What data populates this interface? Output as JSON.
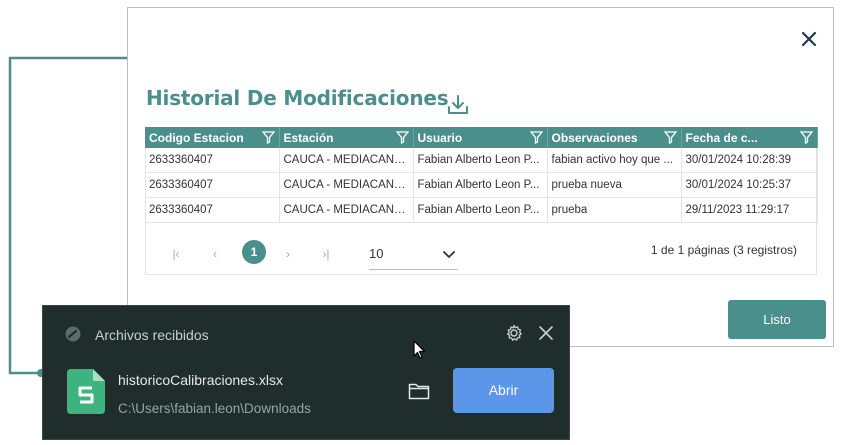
{
  "modal": {
    "title": "Historial De Modificaciones",
    "columns": [
      {
        "label": "Codigo Estacion"
      },
      {
        "label": "Estación"
      },
      {
        "label": "Usuario"
      },
      {
        "label": "Observaciones"
      },
      {
        "label": "Fecha de c..."
      }
    ],
    "rows": [
      {
        "codigo": "2633360407",
        "estacion": "CAUCA - MEDIACANOA",
        "usuario": "Fabian Alberto Leon P...",
        "observaciones": "fabian activo hoy que ...",
        "fecha": "30/01/2024 10:28:39"
      },
      {
        "codigo": "2633360407",
        "estacion": "CAUCA - MEDIACANOA",
        "usuario": "Fabian Alberto Leon P...",
        "observaciones": "prueba nueva",
        "fecha": "30/01/2024 10:25:37"
      },
      {
        "codigo": "2633360407",
        "estacion": "CAUCA - MEDIACANOA",
        "usuario": "Fabian Alberto Leon P...",
        "observaciones": "prueba",
        "fecha": "29/11/2023 11:29:17"
      }
    ],
    "pager": {
      "first": "|‹",
      "prev": "‹",
      "current_page": "1",
      "next": "›",
      "last": "›|",
      "page_size": "10",
      "info": "1 de 1 páginas (3 registros)"
    },
    "done_label": "Listo"
  },
  "toast": {
    "title": "Archivos recibidos",
    "file_name": "historicoCalibraciones.xlsx",
    "file_path": "C:\\Users\\fabian.leon\\Downloads",
    "open_label": "Abrir"
  },
  "colors": {
    "accent": "#4a8f8c",
    "toast_bg": "#1f2d2d",
    "open_button": "#5b96e8",
    "excel_icon": "#3fb37f"
  }
}
